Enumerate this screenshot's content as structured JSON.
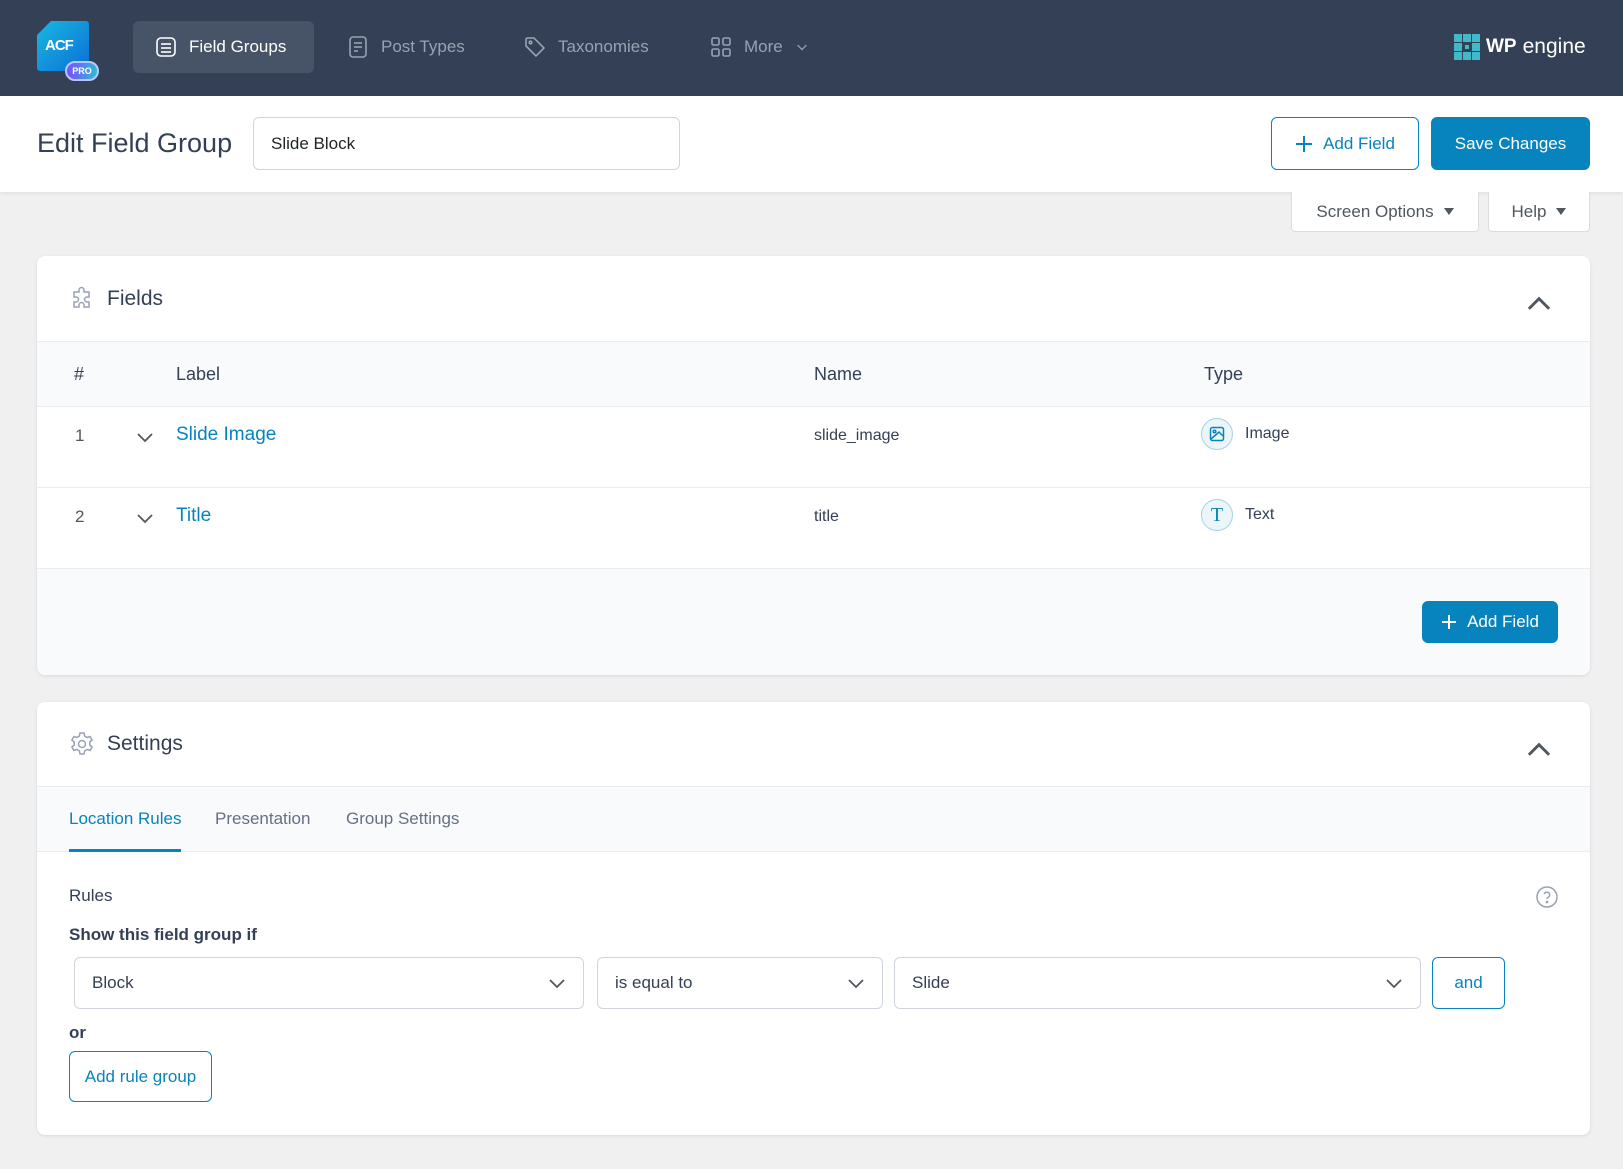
{
  "nav": {
    "logo": {
      "text": "ACF",
      "badge": "PRO"
    },
    "items": [
      {
        "label": "Field Groups",
        "icon": "list-icon",
        "active": true
      },
      {
        "label": "Post Types",
        "icon": "document-icon",
        "active": false
      },
      {
        "label": "Taxonomies",
        "icon": "tag-icon",
        "active": false
      },
      {
        "label": "More",
        "icon": "grid-icon",
        "active": false
      }
    ],
    "brand": {
      "bold": "WP",
      "light": "engine"
    }
  },
  "header": {
    "title": "Edit Field Group",
    "group_name_value": "Slide Block",
    "add_field_label": "Add Field",
    "save_label": "Save Changes"
  },
  "screen_tabs": {
    "screen_options": "Screen Options",
    "help": "Help"
  },
  "fields_panel": {
    "title": "Fields",
    "columns": [
      "#",
      "Label",
      "Name",
      "Type"
    ],
    "rows": [
      {
        "num": "1",
        "label": "Slide Image",
        "name": "slide_image",
        "type": "Image",
        "type_icon": "image-icon"
      },
      {
        "num": "2",
        "label": "Title",
        "name": "title",
        "type": "Text",
        "type_icon": "text-icon"
      }
    ],
    "add_field_label": "Add Field"
  },
  "settings_panel": {
    "title": "Settings",
    "tabs": [
      {
        "label": "Location Rules",
        "active": true
      },
      {
        "label": "Presentation",
        "active": false
      },
      {
        "label": "Group Settings",
        "active": false
      }
    ],
    "rules_label": "Rules",
    "show_if_label": "Show this field group if",
    "rule": {
      "param": "Block",
      "operator": "is equal to",
      "value": "Slide"
    },
    "and_label": "and",
    "or_label": "or",
    "add_rule_group_label": "Add rule group"
  },
  "colors": {
    "accent": "#0783be",
    "nav_bg": "#344055",
    "nav_active": "#475467"
  }
}
